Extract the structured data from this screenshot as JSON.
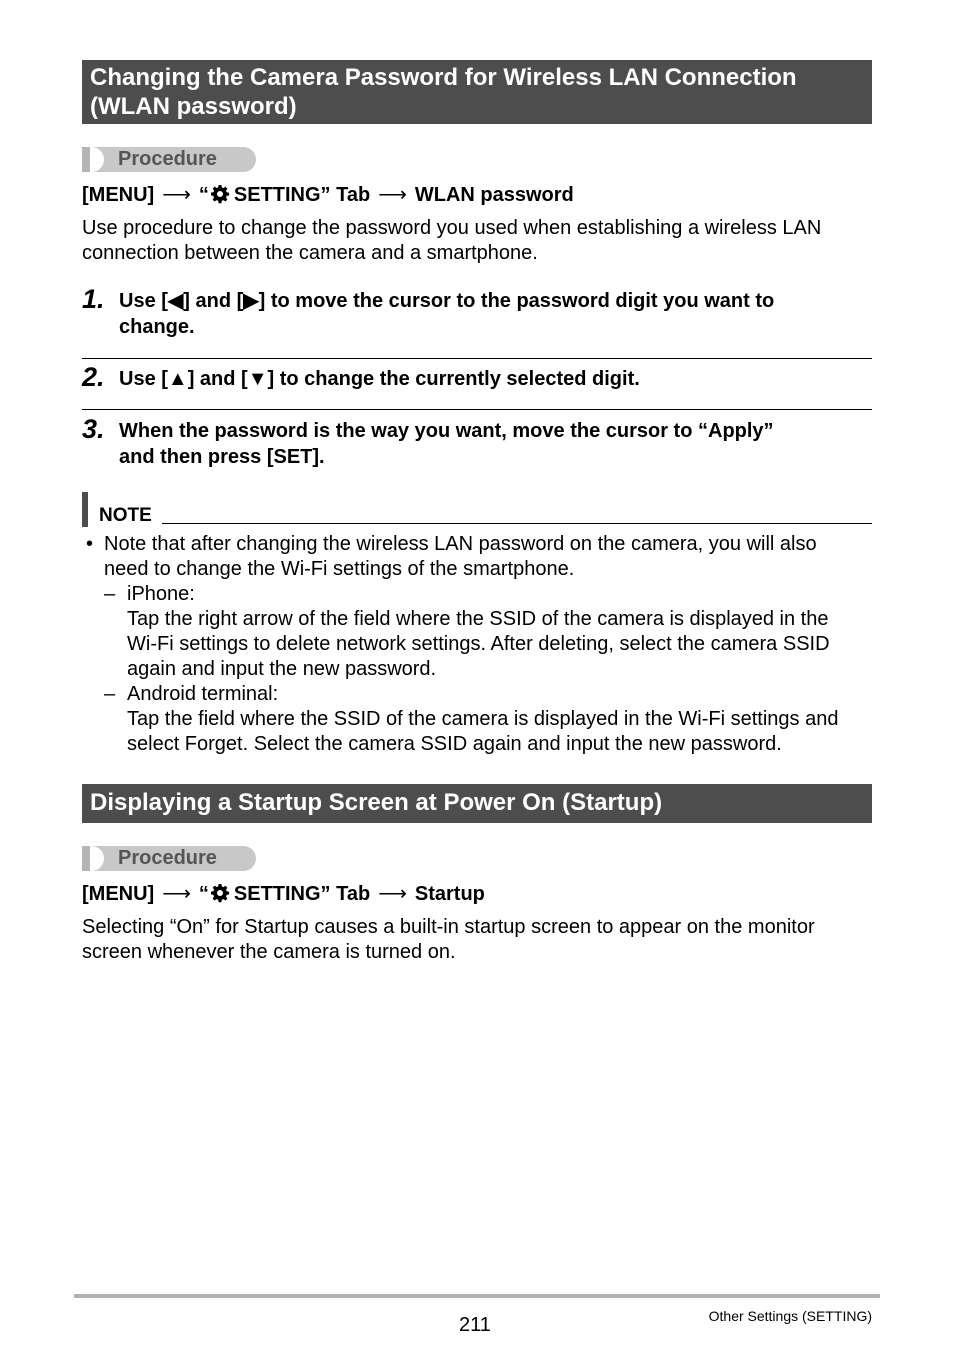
{
  "section1": {
    "title_line1": "Changing the Camera Password for Wireless LAN Connection",
    "title_line2": "(WLAN password)",
    "procedure_label": "Procedure",
    "menu_path": {
      "menu": "[MENU]",
      "arrow": "⟶",
      "tab_open_quote": "“",
      "tab": "SETTING” Tab",
      "target": "WLAN password"
    },
    "intro_line1": "Use procedure to change the password you used when establishing a wireless LAN",
    "intro_line2": "connection between the camera and a smartphone.",
    "steps": [
      {
        "num": "1.",
        "line1": "Use [◀] and [▶] to move the cursor to the password digit you want to",
        "line2": "change."
      },
      {
        "num": "2.",
        "line1": "Use [▲] and [▼] to change the currently selected digit."
      },
      {
        "num": "3.",
        "line1": "When the password is the way you want, move the cursor to “Apply”",
        "line2": "and then press [SET]."
      }
    ],
    "note": {
      "label": "NOTE",
      "bullet": "•",
      "lines": [
        "Note that after changing the wireless LAN password on the camera, you will also",
        "need to change the Wi-Fi settings of the smartphone."
      ],
      "dash": "–",
      "iphone_label": "iPhone:",
      "iphone_lines": [
        "Tap the right arrow of the field where the SSID of the camera is displayed in the",
        "Wi-Fi settings to delete network settings. After deleting, select the camera SSID",
        "again and input the new password."
      ],
      "android_label": "Android terminal:",
      "android_lines": [
        "Tap the field where the SSID of the camera is displayed in the Wi-Fi settings and",
        "select Forget. Select the camera SSID again and input the new password."
      ]
    }
  },
  "section2": {
    "title": "Displaying a Startup Screen at Power On (Startup)",
    "procedure_label": "Procedure",
    "menu_path": {
      "menu": "[MENU]",
      "arrow": "⟶",
      "tab_open_quote": "“",
      "tab": "SETTING” Tab",
      "target": "Startup"
    },
    "body_line1": "Selecting “On” for Startup causes a built-in startup screen to appear on the monitor",
    "body_line2": "screen whenever the camera is turned on."
  },
  "footer": {
    "page_number": "211",
    "section_name": "Other Settings (SETTING)"
  }
}
